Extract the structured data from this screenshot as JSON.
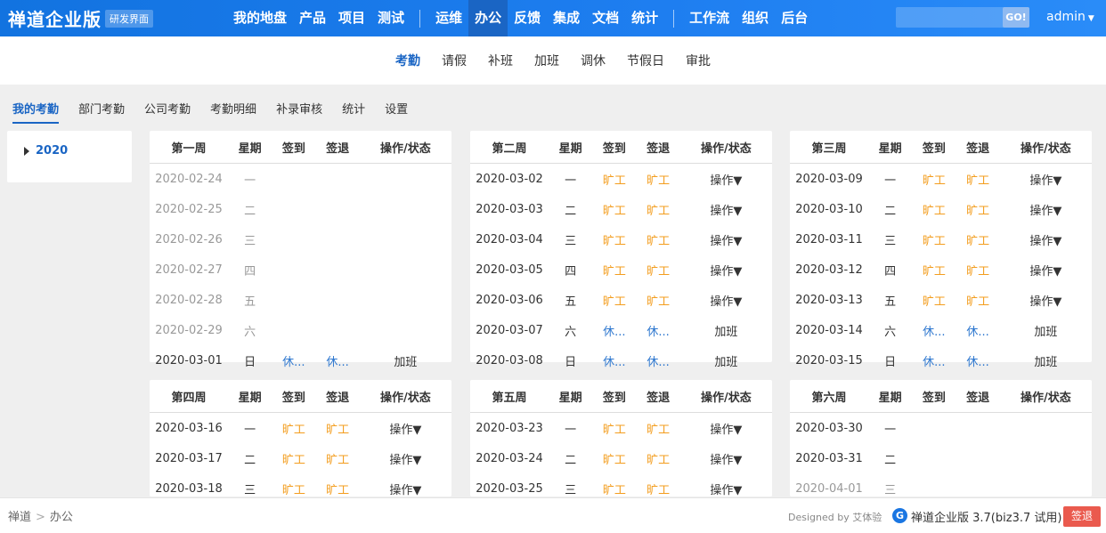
{
  "header": {
    "brand": "禅道企业版",
    "badge": "研发界面",
    "nav": [
      {
        "label": "我的地盘"
      },
      {
        "label": "产品"
      },
      {
        "label": "项目"
      },
      {
        "label": "测试"
      },
      {
        "sep": true
      },
      {
        "label": "运维"
      },
      {
        "label": "办公",
        "active": true
      },
      {
        "label": "反馈"
      },
      {
        "label": "集成"
      },
      {
        "label": "文档"
      },
      {
        "label": "统计"
      },
      {
        "sep": true
      },
      {
        "label": "工作流"
      },
      {
        "label": "组织"
      },
      {
        "label": "后台"
      }
    ],
    "search_value": "",
    "go_label": "GO!",
    "user": "admin"
  },
  "subnav": [
    {
      "label": "考勤",
      "active": true
    },
    {
      "label": "请假"
    },
    {
      "label": "补班"
    },
    {
      "label": "加班"
    },
    {
      "label": "调休"
    },
    {
      "label": "节假日"
    },
    {
      "label": "审批"
    }
  ],
  "tabs": [
    {
      "label": "我的考勤",
      "active": true
    },
    {
      "label": "部门考勤"
    },
    {
      "label": "公司考勤"
    },
    {
      "label": "考勤明细"
    },
    {
      "label": "补录审核"
    },
    {
      "label": "统计"
    },
    {
      "label": "设置"
    }
  ],
  "year": "2020",
  "columns": [
    "星期",
    "签到",
    "签退",
    "操作/状态"
  ],
  "weeks": [
    {
      "title": "第一周",
      "rows": [
        {
          "date": "2020-02-24",
          "day": "一",
          "muted": true,
          "in": "",
          "out": "",
          "action": ""
        },
        {
          "date": "2020-02-25",
          "day": "二",
          "muted": true,
          "in": "",
          "out": "",
          "action": ""
        },
        {
          "date": "2020-02-26",
          "day": "三",
          "muted": true,
          "in": "",
          "out": "",
          "action": ""
        },
        {
          "date": "2020-02-27",
          "day": "四",
          "muted": true,
          "in": "",
          "out": "",
          "action": ""
        },
        {
          "date": "2020-02-28",
          "day": "五",
          "muted": true,
          "in": "",
          "out": "",
          "action": ""
        },
        {
          "date": "2020-02-29",
          "day": "六",
          "muted": true,
          "in": "",
          "out": "",
          "action": ""
        },
        {
          "date": "2020-03-01",
          "day": "日",
          "in": "休...",
          "out": "休...",
          "status": "rest",
          "action": "加班"
        }
      ]
    },
    {
      "title": "第二周",
      "rows": [
        {
          "date": "2020-03-02",
          "day": "一",
          "in": "旷工",
          "out": "旷工",
          "status": "absent",
          "action": "操作",
          "dropdown": true
        },
        {
          "date": "2020-03-03",
          "day": "二",
          "in": "旷工",
          "out": "旷工",
          "status": "absent",
          "action": "操作",
          "dropdown": true
        },
        {
          "date": "2020-03-04",
          "day": "三",
          "in": "旷工",
          "out": "旷工",
          "status": "absent",
          "action": "操作",
          "dropdown": true
        },
        {
          "date": "2020-03-05",
          "day": "四",
          "in": "旷工",
          "out": "旷工",
          "status": "absent",
          "action": "操作",
          "dropdown": true
        },
        {
          "date": "2020-03-06",
          "day": "五",
          "in": "旷工",
          "out": "旷工",
          "status": "absent",
          "action": "操作",
          "dropdown": true
        },
        {
          "date": "2020-03-07",
          "day": "六",
          "in": "休...",
          "out": "休...",
          "status": "rest",
          "action": "加班"
        },
        {
          "date": "2020-03-08",
          "day": "日",
          "in": "休...",
          "out": "休...",
          "status": "rest",
          "action": "加班"
        }
      ]
    },
    {
      "title": "第三周",
      "rows": [
        {
          "date": "2020-03-09",
          "day": "一",
          "in": "旷工",
          "out": "旷工",
          "status": "absent",
          "action": "操作",
          "dropdown": true
        },
        {
          "date": "2020-03-10",
          "day": "二",
          "in": "旷工",
          "out": "旷工",
          "status": "absent",
          "action": "操作",
          "dropdown": true
        },
        {
          "date": "2020-03-11",
          "day": "三",
          "in": "旷工",
          "out": "旷工",
          "status": "absent",
          "action": "操作",
          "dropdown": true
        },
        {
          "date": "2020-03-12",
          "day": "四",
          "in": "旷工",
          "out": "旷工",
          "status": "absent",
          "action": "操作",
          "dropdown": true
        },
        {
          "date": "2020-03-13",
          "day": "五",
          "in": "旷工",
          "out": "旷工",
          "status": "absent",
          "action": "操作",
          "dropdown": true
        },
        {
          "date": "2020-03-14",
          "day": "六",
          "in": "休...",
          "out": "休...",
          "status": "rest",
          "action": "加班"
        },
        {
          "date": "2020-03-15",
          "day": "日",
          "in": "休...",
          "out": "休...",
          "status": "rest",
          "action": "加班"
        }
      ]
    },
    {
      "title": "第四周",
      "rows": [
        {
          "date": "2020-03-16",
          "day": "一",
          "in": "旷工",
          "out": "旷工",
          "status": "absent",
          "action": "操作",
          "dropdown": true
        },
        {
          "date": "2020-03-17",
          "day": "二",
          "in": "旷工",
          "out": "旷工",
          "status": "absent",
          "action": "操作",
          "dropdown": true
        },
        {
          "date": "2020-03-18",
          "day": "三",
          "in": "旷工",
          "out": "旷工",
          "status": "absent",
          "action": "操作",
          "dropdown": true
        }
      ]
    },
    {
      "title": "第五周",
      "rows": [
        {
          "date": "2020-03-23",
          "day": "一",
          "in": "旷工",
          "out": "旷工",
          "status": "absent",
          "action": "操作",
          "dropdown": true
        },
        {
          "date": "2020-03-24",
          "day": "二",
          "in": "旷工",
          "out": "旷工",
          "status": "absent",
          "action": "操作",
          "dropdown": true
        },
        {
          "date": "2020-03-25",
          "day": "三",
          "in": "旷工",
          "out": "旷工",
          "status": "absent",
          "action": "操作",
          "dropdown": true
        }
      ]
    },
    {
      "title": "第六周",
      "rows": [
        {
          "date": "2020-03-30",
          "day": "一",
          "in": "",
          "out": "",
          "action": ""
        },
        {
          "date": "2020-03-31",
          "day": "二",
          "in": "",
          "out": "",
          "action": ""
        },
        {
          "date": "2020-04-01",
          "day": "三",
          "muted": true,
          "in": "",
          "out": "",
          "action": ""
        }
      ]
    }
  ],
  "footer": {
    "crumbs": [
      "禅道",
      "办公"
    ],
    "designed_by": "Designed by 艾体验",
    "version": "禅道企业版 3.7(biz3.7 试用)",
    "logout": "签退"
  },
  "colors": {
    "primary": "#1a65c4",
    "absent": "#f39d1e",
    "rest": "#2f78cf",
    "logout": "#ea5a4e"
  }
}
